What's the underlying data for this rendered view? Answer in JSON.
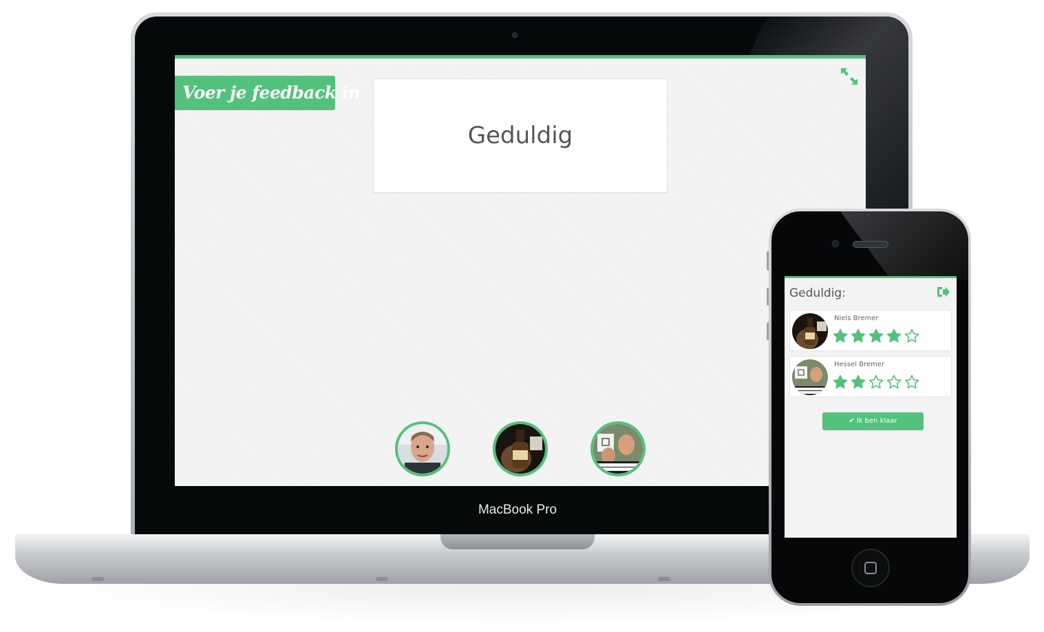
{
  "laptop": {
    "brand_label": "MacBook Pro",
    "screen": {
      "ribbon_label": "Voer je feedback in",
      "word_card_text": "Geduldig",
      "expand_icon": "expand-icon",
      "avatars": [
        {
          "name": "avatar-1",
          "icon": "person-photo"
        },
        {
          "name": "avatar-2",
          "icon": "person-with-bottle-photo"
        },
        {
          "name": "avatar-3",
          "icon": "people-with-sign-photo"
        }
      ]
    }
  },
  "phone": {
    "title": "Geduldig:",
    "logout_icon": "logout-icon",
    "ratings": [
      {
        "name": "Niels Bremer",
        "stars": 4,
        "max": 5
      },
      {
        "name": "Hessel Bremer",
        "stars": 2,
        "max": 5
      }
    ],
    "done_label": "Ik ben klaar",
    "done_icon": "check-icon"
  },
  "colors": {
    "accent": "#53c17b",
    "screen_bg": "#f4f4f4",
    "text_muted": "#555555"
  }
}
